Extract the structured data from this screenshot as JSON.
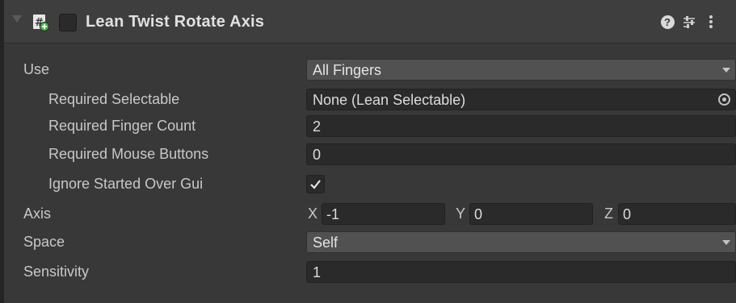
{
  "component": {
    "title": "Lean Twist Rotate Axis",
    "enabled": false,
    "icons": [
      "script-icon",
      "help-icon",
      "preset-icon",
      "menu-icon"
    ],
    "help_glyph": "?"
  },
  "fields": {
    "use": {
      "label": "Use",
      "value": "All Fingers"
    },
    "required_selectable": {
      "label": "Required Selectable",
      "value": "None (Lean Selectable)"
    },
    "required_finger_count": {
      "label": "Required Finger Count",
      "value": "2"
    },
    "required_mouse_buttons": {
      "label": "Required Mouse Buttons",
      "value": "0"
    },
    "ignore_started_over_gui": {
      "label": "Ignore Started Over Gui",
      "checked": true
    },
    "axis": {
      "label": "Axis",
      "x_label": "X",
      "x": "-1",
      "y_label": "Y",
      "y": "0",
      "z_label": "Z",
      "z": "0"
    },
    "space": {
      "label": "Space",
      "value": "Self"
    },
    "sensitivity": {
      "label": "Sensitivity",
      "value": "1"
    }
  },
  "colors": {
    "background": "#383838",
    "header": "#3e3e3e",
    "field": "#2a2a2a",
    "dropdown": "#515151",
    "text": "#c8c8c8",
    "script_icon_green": "#4caf50"
  }
}
